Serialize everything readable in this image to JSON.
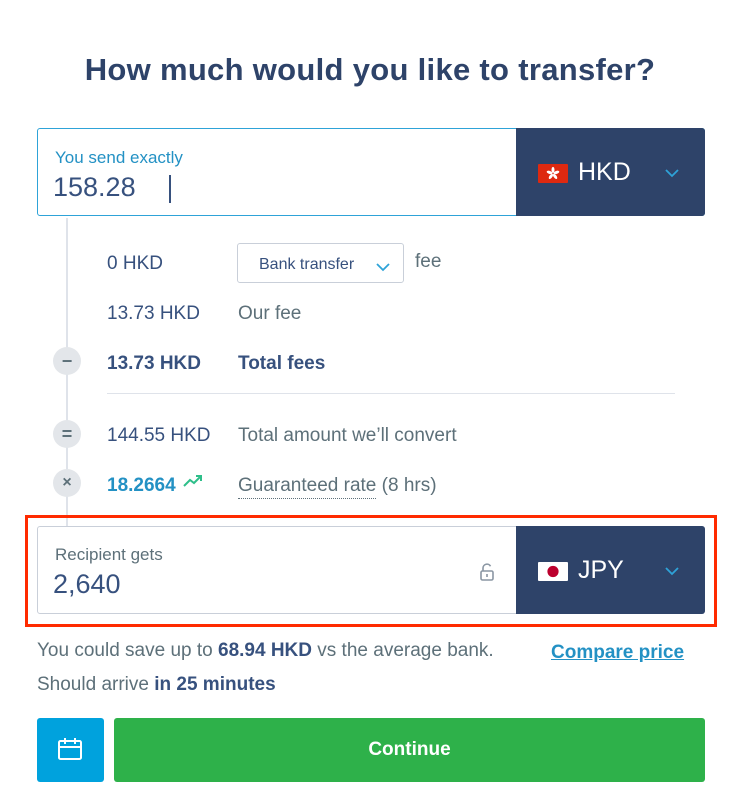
{
  "title": "How much would you like to transfer?",
  "send": {
    "label": "You send exactly",
    "value": "158.28",
    "currency": "HKD"
  },
  "fees": {
    "method_fee_amount": "0 HKD",
    "method_select": "Bank transfer",
    "method_suffix": "fee",
    "our_fee_amount": "13.73 HKD",
    "our_fee_label": "Our fee",
    "total_fees_amount": "13.73 HKD",
    "total_fees_label": "Total fees",
    "convert_amount": "144.55 HKD",
    "convert_label": "Total amount we’ll convert",
    "rate": "18.2664",
    "rate_label": "Guaranteed rate",
    "rate_duration": "(8 hrs)",
    "minus_symbol": "−",
    "equals_symbol": "=",
    "times_symbol": "×"
  },
  "receive": {
    "label": "Recipient gets",
    "value": "2,640",
    "currency": "JPY"
  },
  "savings": {
    "prefix": "You could save up to",
    "amount": "68.94 HKD",
    "suffix": "vs the average bank.",
    "compare_link": "Compare price"
  },
  "arrival": {
    "prefix": "Should arrive",
    "time": "in 25 minutes"
  },
  "buttons": {
    "continue": "Continue"
  },
  "icons": {
    "send_flag": "hong-kong-flag-icon",
    "receive_flag": "japan-flag-icon",
    "dropdown": "chevron-down-icon",
    "lock": "unlock-icon",
    "trend": "trend-up-icon",
    "calendar": "calendar-icon"
  },
  "colors": {
    "primary_navy": "#2e4369",
    "link_blue": "#2391c4",
    "accent_blue": "#00a2dd",
    "continue_green": "#2eb14a",
    "highlight_red": "#ff2a00",
    "trend_green": "#2ebf8a"
  }
}
